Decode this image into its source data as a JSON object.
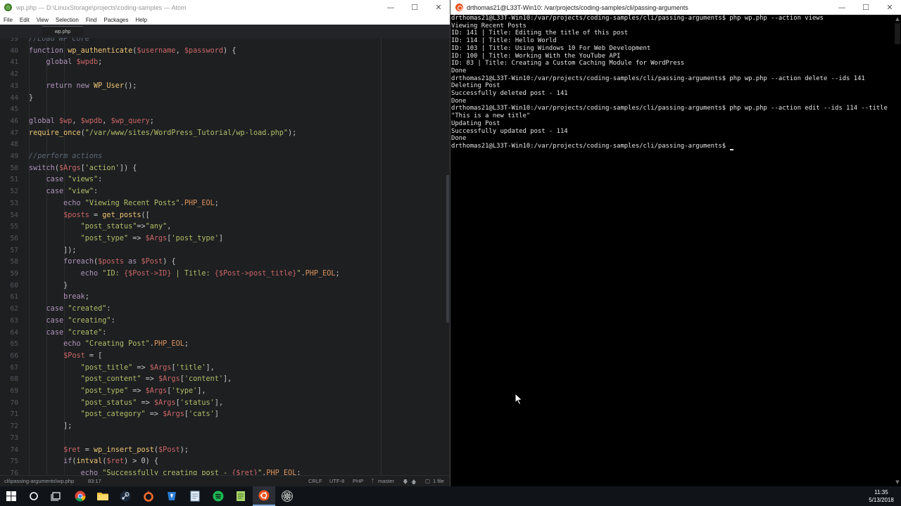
{
  "atom": {
    "title": "wp.php — D:\\LinuxStorage\\projects\\coding-samples — Atom",
    "menu": [
      "File",
      "Edit",
      "View",
      "Selection",
      "Find",
      "Packages",
      "Help"
    ],
    "tab_label": "wp.php",
    "status": {
      "path": "cli\\passing-arguments\\wp.php",
      "cursor": "83:17",
      "line_ending": "CRLF",
      "encoding": "UTF-8",
      "grammar": "PHP",
      "branch": "master",
      "files": "1 file"
    }
  },
  "editor": {
    "first_line_number": 39,
    "lines": [
      [
        [
          "c",
          "//Load WP Core"
        ]
      ],
      [
        [
          "k",
          "function "
        ],
        [
          "f",
          "wp_authenticate"
        ],
        [
          "p",
          "("
        ],
        [
          "v",
          "$username"
        ],
        [
          "p",
          ", "
        ],
        [
          "v",
          "$password"
        ],
        [
          "p",
          ") {"
        ]
      ],
      [
        [
          "p",
          "    "
        ],
        [
          "k",
          "global "
        ],
        [
          "v",
          "$wpdb"
        ],
        [
          "p",
          ";"
        ]
      ],
      [],
      [
        [
          "p",
          "    "
        ],
        [
          "k",
          "return new "
        ],
        [
          "f",
          "WP_User"
        ],
        [
          "p",
          "();"
        ]
      ],
      [
        [
          "p",
          "}"
        ]
      ],
      [],
      [
        [
          "k",
          "global "
        ],
        [
          "v",
          "$wp"
        ],
        [
          "p",
          ", "
        ],
        [
          "v",
          "$wpdb"
        ],
        [
          "p",
          ", "
        ],
        [
          "v",
          "$wp_query"
        ],
        [
          "p",
          ";"
        ]
      ],
      [
        [
          "f",
          "require_once"
        ],
        [
          "p",
          "("
        ],
        [
          "s",
          "\"/var/www/sites/WordPress_Tutorial/wp-load.php\""
        ],
        [
          "p",
          ");"
        ]
      ],
      [],
      [
        [
          "c",
          "//perform actions"
        ]
      ],
      [
        [
          "k",
          "switch"
        ],
        [
          "p",
          "("
        ],
        [
          "v",
          "$Args"
        ],
        [
          "p",
          "["
        ],
        [
          "s",
          "'action'"
        ],
        [
          "p",
          "]) {"
        ]
      ],
      [
        [
          "p",
          "    "
        ],
        [
          "k",
          "case "
        ],
        [
          "s",
          "\"views\""
        ],
        [
          "p",
          ":"
        ]
      ],
      [
        [
          "p",
          "    "
        ],
        [
          "k",
          "case "
        ],
        [
          "s",
          "\"view\""
        ],
        [
          "p",
          ":"
        ]
      ],
      [
        [
          "p",
          "        "
        ],
        [
          "k",
          "echo "
        ],
        [
          "s",
          "\"Viewing Recent Posts\""
        ],
        [
          "p",
          "."
        ],
        [
          "cst",
          "PHP_EOL"
        ],
        [
          "p",
          ";"
        ]
      ],
      [
        [
          "p",
          "        "
        ],
        [
          "v",
          "$posts"
        ],
        [
          "p",
          " = "
        ],
        [
          "f",
          "get_posts"
        ],
        [
          "p",
          "(["
        ]
      ],
      [
        [
          "p",
          "            "
        ],
        [
          "s",
          "\"post_status\""
        ],
        [
          "p",
          "=>"
        ],
        [
          "s",
          "\"any\""
        ],
        [
          "p",
          ","
        ]
      ],
      [
        [
          "p",
          "            "
        ],
        [
          "s",
          "\"post_type\""
        ],
        [
          "p",
          " => "
        ],
        [
          "v",
          "$Args"
        ],
        [
          "p",
          "["
        ],
        [
          "s",
          "'post_type'"
        ],
        [
          "p",
          "]"
        ]
      ],
      [
        [
          "p",
          "        ]);"
        ]
      ],
      [
        [
          "p",
          "        "
        ],
        [
          "k",
          "foreach"
        ],
        [
          "p",
          "("
        ],
        [
          "v",
          "$posts"
        ],
        [
          "k",
          " as "
        ],
        [
          "v",
          "$Post"
        ],
        [
          "p",
          ") {"
        ]
      ],
      [
        [
          "p",
          "            "
        ],
        [
          "k",
          "echo "
        ],
        [
          "s",
          "\"ID: "
        ],
        [
          "v",
          "{$Post->ID}"
        ],
        [
          "s",
          " | Title: "
        ],
        [
          "v",
          "{$Post->post_title}"
        ],
        [
          "s",
          "\""
        ],
        [
          "p",
          "."
        ],
        [
          "cst",
          "PHP_EOL"
        ],
        [
          "p",
          ";"
        ]
      ],
      [
        [
          "p",
          "        }"
        ]
      ],
      [
        [
          "p",
          "        "
        ],
        [
          "k",
          "break"
        ],
        [
          "p",
          ";"
        ]
      ],
      [
        [
          "p",
          "    "
        ],
        [
          "k",
          "case "
        ],
        [
          "s",
          "\"created\""
        ],
        [
          "p",
          ":"
        ]
      ],
      [
        [
          "p",
          "    "
        ],
        [
          "k",
          "case "
        ],
        [
          "s",
          "\"creating\""
        ],
        [
          "p",
          ":"
        ]
      ],
      [
        [
          "p",
          "    "
        ],
        [
          "k",
          "case "
        ],
        [
          "s",
          "\"create\""
        ],
        [
          "p",
          ":"
        ]
      ],
      [
        [
          "p",
          "        "
        ],
        [
          "k",
          "echo "
        ],
        [
          "s",
          "\"Creating Post\""
        ],
        [
          "p",
          "."
        ],
        [
          "cst",
          "PHP_EOL"
        ],
        [
          "p",
          ";"
        ]
      ],
      [
        [
          "p",
          "        "
        ],
        [
          "v",
          "$Post"
        ],
        [
          "p",
          " = ["
        ]
      ],
      [
        [
          "p",
          "            "
        ],
        [
          "s",
          "\"post_title\""
        ],
        [
          "p",
          " => "
        ],
        [
          "v",
          "$Args"
        ],
        [
          "p",
          "["
        ],
        [
          "s",
          "'title'"
        ],
        [
          "p",
          "],"
        ]
      ],
      [
        [
          "p",
          "            "
        ],
        [
          "s",
          "\"post_content\""
        ],
        [
          "p",
          " => "
        ],
        [
          "v",
          "$Args"
        ],
        [
          "p",
          "["
        ],
        [
          "s",
          "'content'"
        ],
        [
          "p",
          "],"
        ]
      ],
      [
        [
          "p",
          "            "
        ],
        [
          "s",
          "\"post_type\""
        ],
        [
          "p",
          " => "
        ],
        [
          "v",
          "$Args"
        ],
        [
          "p",
          "["
        ],
        [
          "s",
          "'type'"
        ],
        [
          "p",
          "],"
        ]
      ],
      [
        [
          "p",
          "            "
        ],
        [
          "s",
          "\"post_status\""
        ],
        [
          "p",
          " => "
        ],
        [
          "v",
          "$Args"
        ],
        [
          "p",
          "["
        ],
        [
          "s",
          "'status'"
        ],
        [
          "p",
          "],"
        ]
      ],
      [
        [
          "p",
          "            "
        ],
        [
          "s",
          "\"post_category\""
        ],
        [
          "p",
          " => "
        ],
        [
          "v",
          "$Args"
        ],
        [
          "p",
          "["
        ],
        [
          "s",
          "'cats'"
        ],
        [
          "p",
          "]"
        ]
      ],
      [
        [
          "p",
          "        ];"
        ]
      ],
      [],
      [
        [
          "p",
          "        "
        ],
        [
          "v",
          "$ret"
        ],
        [
          "p",
          " = "
        ],
        [
          "f",
          "wp_insert_post"
        ],
        [
          "p",
          "("
        ],
        [
          "v",
          "$Post"
        ],
        [
          "p",
          ");"
        ]
      ],
      [
        [
          "p",
          "        "
        ],
        [
          "k",
          "if"
        ],
        [
          "p",
          "("
        ],
        [
          "f",
          "intval"
        ],
        [
          "p",
          "("
        ],
        [
          "v",
          "$ret"
        ],
        [
          "p",
          ") > 0) {"
        ]
      ],
      [
        [
          "p",
          "            "
        ],
        [
          "k",
          "echo "
        ],
        [
          "s",
          "\"Successfully creating post - "
        ],
        [
          "v",
          "{$ret}"
        ],
        [
          "s",
          "\""
        ],
        [
          "p",
          "."
        ],
        [
          "cst",
          "PHP_EOL"
        ],
        [
          "p",
          ";"
        ]
      ]
    ]
  },
  "terminal": {
    "title": "drthomas21@L33T-Win10: /var/projects/coding-samples/cli/passing-arguments",
    "lines": [
      "drthomas21@L33T-Win10:/var/projects/coding-samples/cli/passing-arguments$ php wp.php --action views",
      "Viewing Recent Posts",
      "ID: 141 | Title: Editing the title of this post",
      "ID: 114 | Title: Hello World",
      "ID: 103 | Title: Using Windows 10 For Web Development",
      "ID: 100 | Title: Working With the YouTube API",
      "ID: 83 | Title: Creating a Custom Caching Module for WordPress",
      "Done",
      "drthomas21@L33T-Win10:/var/projects/coding-samples/cli/passing-arguments$ php wp.php --action delete --ids 141",
      "Deleting Post",
      "Successfully deleted post - 141",
      "Done",
      "drthomas21@L33T-Win10:/var/projects/coding-samples/cli/passing-arguments$ php wp.php --action edit --ids 114 --title",
      "\"This is a new title\"",
      "Updating Post",
      "Successfully updated post - 114",
      "Done",
      "drthomas21@L33T-Win10:/var/projects/coding-samples/cli/passing-arguments$ "
    ]
  },
  "taskbar": {
    "apps": [
      "start-icon",
      "cortana-icon",
      "task-view-icon",
      "chrome-icon",
      "file-explorer-icon",
      "steam-icon",
      "origin-icon",
      "app-icon",
      "notepad-icon",
      "spotify-icon",
      "notepadpp-icon",
      "ubuntu-icon",
      "atom-icon"
    ],
    "time": "11:35",
    "date": "5/13/2018"
  },
  "colors": {
    "keyword": "#b294bb",
    "function": "#f0c674",
    "variable": "#cc6666",
    "string": "#b5bd68",
    "comment": "#5e6a78",
    "constant": "#de935f",
    "editor_bg": "#1d1f21",
    "terminal_bg": "#000000"
  }
}
